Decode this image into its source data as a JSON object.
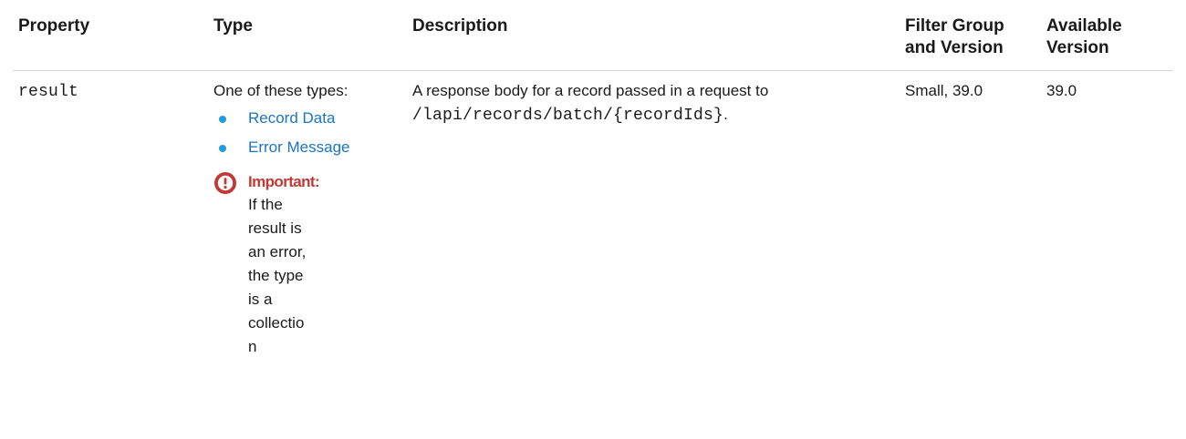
{
  "table": {
    "headers": {
      "property": "Property",
      "type": "Type",
      "description": "Description",
      "filter_group": "Filter Group and Version",
      "available_version": "Available Version"
    },
    "rows": [
      {
        "property": "result",
        "type_intro": "One of these types:",
        "type_links": [
          "Record Data",
          "Error Message"
        ],
        "important_label": "Important:",
        "important_text": "If the result is an error, the type is a collection",
        "description_prefix": "A response body for a record passed in a request to ",
        "description_code": "/lapi/records/batch/{recordIds}",
        "description_suffix": ".",
        "filter_group": "Small, 39.0",
        "available_version": "39.0"
      }
    ]
  },
  "colors": {
    "link": "#1b74c5",
    "bullet": "#1f9bde",
    "important": "#c23934"
  },
  "icons": {
    "important": "exclamation-circle-icon"
  }
}
